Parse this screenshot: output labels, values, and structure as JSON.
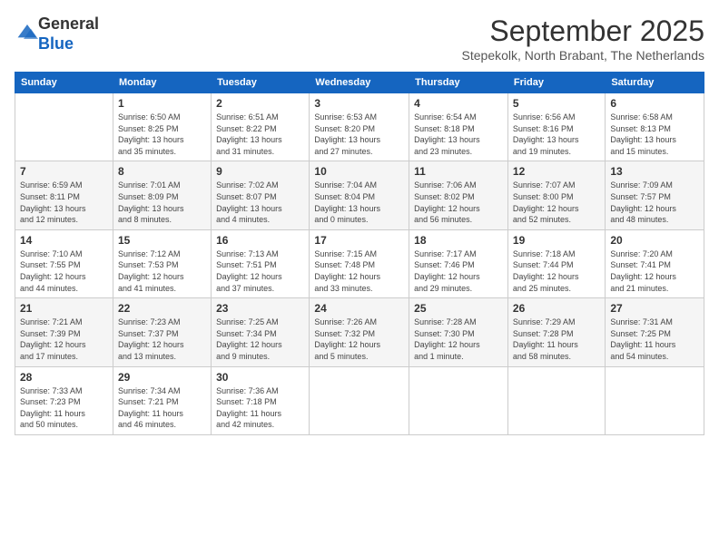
{
  "logo": {
    "general": "General",
    "blue": "Blue"
  },
  "header": {
    "month": "September 2025",
    "location": "Stepekolk, North Brabant, The Netherlands"
  },
  "days_of_week": [
    "Sunday",
    "Monday",
    "Tuesday",
    "Wednesday",
    "Thursday",
    "Friday",
    "Saturday"
  ],
  "weeks": [
    [
      {
        "day": "",
        "info": ""
      },
      {
        "day": "1",
        "info": "Sunrise: 6:50 AM\nSunset: 8:25 PM\nDaylight: 13 hours\nand 35 minutes."
      },
      {
        "day": "2",
        "info": "Sunrise: 6:51 AM\nSunset: 8:22 PM\nDaylight: 13 hours\nand 31 minutes."
      },
      {
        "day": "3",
        "info": "Sunrise: 6:53 AM\nSunset: 8:20 PM\nDaylight: 13 hours\nand 27 minutes."
      },
      {
        "day": "4",
        "info": "Sunrise: 6:54 AM\nSunset: 8:18 PM\nDaylight: 13 hours\nand 23 minutes."
      },
      {
        "day": "5",
        "info": "Sunrise: 6:56 AM\nSunset: 8:16 PM\nDaylight: 13 hours\nand 19 minutes."
      },
      {
        "day": "6",
        "info": "Sunrise: 6:58 AM\nSunset: 8:13 PM\nDaylight: 13 hours\nand 15 minutes."
      }
    ],
    [
      {
        "day": "7",
        "info": "Sunrise: 6:59 AM\nSunset: 8:11 PM\nDaylight: 13 hours\nand 12 minutes."
      },
      {
        "day": "8",
        "info": "Sunrise: 7:01 AM\nSunset: 8:09 PM\nDaylight: 13 hours\nand 8 minutes."
      },
      {
        "day": "9",
        "info": "Sunrise: 7:02 AM\nSunset: 8:07 PM\nDaylight: 13 hours\nand 4 minutes."
      },
      {
        "day": "10",
        "info": "Sunrise: 7:04 AM\nSunset: 8:04 PM\nDaylight: 13 hours\nand 0 minutes."
      },
      {
        "day": "11",
        "info": "Sunrise: 7:06 AM\nSunset: 8:02 PM\nDaylight: 12 hours\nand 56 minutes."
      },
      {
        "day": "12",
        "info": "Sunrise: 7:07 AM\nSunset: 8:00 PM\nDaylight: 12 hours\nand 52 minutes."
      },
      {
        "day": "13",
        "info": "Sunrise: 7:09 AM\nSunset: 7:57 PM\nDaylight: 12 hours\nand 48 minutes."
      }
    ],
    [
      {
        "day": "14",
        "info": "Sunrise: 7:10 AM\nSunset: 7:55 PM\nDaylight: 12 hours\nand 44 minutes."
      },
      {
        "day": "15",
        "info": "Sunrise: 7:12 AM\nSunset: 7:53 PM\nDaylight: 12 hours\nand 41 minutes."
      },
      {
        "day": "16",
        "info": "Sunrise: 7:13 AM\nSunset: 7:51 PM\nDaylight: 12 hours\nand 37 minutes."
      },
      {
        "day": "17",
        "info": "Sunrise: 7:15 AM\nSunset: 7:48 PM\nDaylight: 12 hours\nand 33 minutes."
      },
      {
        "day": "18",
        "info": "Sunrise: 7:17 AM\nSunset: 7:46 PM\nDaylight: 12 hours\nand 29 minutes."
      },
      {
        "day": "19",
        "info": "Sunrise: 7:18 AM\nSunset: 7:44 PM\nDaylight: 12 hours\nand 25 minutes."
      },
      {
        "day": "20",
        "info": "Sunrise: 7:20 AM\nSunset: 7:41 PM\nDaylight: 12 hours\nand 21 minutes."
      }
    ],
    [
      {
        "day": "21",
        "info": "Sunrise: 7:21 AM\nSunset: 7:39 PM\nDaylight: 12 hours\nand 17 minutes."
      },
      {
        "day": "22",
        "info": "Sunrise: 7:23 AM\nSunset: 7:37 PM\nDaylight: 12 hours\nand 13 minutes."
      },
      {
        "day": "23",
        "info": "Sunrise: 7:25 AM\nSunset: 7:34 PM\nDaylight: 12 hours\nand 9 minutes."
      },
      {
        "day": "24",
        "info": "Sunrise: 7:26 AM\nSunset: 7:32 PM\nDaylight: 12 hours\nand 5 minutes."
      },
      {
        "day": "25",
        "info": "Sunrise: 7:28 AM\nSunset: 7:30 PM\nDaylight: 12 hours\nand 1 minute."
      },
      {
        "day": "26",
        "info": "Sunrise: 7:29 AM\nSunset: 7:28 PM\nDaylight: 11 hours\nand 58 minutes."
      },
      {
        "day": "27",
        "info": "Sunrise: 7:31 AM\nSunset: 7:25 PM\nDaylight: 11 hours\nand 54 minutes."
      }
    ],
    [
      {
        "day": "28",
        "info": "Sunrise: 7:33 AM\nSunset: 7:23 PM\nDaylight: 11 hours\nand 50 minutes."
      },
      {
        "day": "29",
        "info": "Sunrise: 7:34 AM\nSunset: 7:21 PM\nDaylight: 11 hours\nand 46 minutes."
      },
      {
        "day": "30",
        "info": "Sunrise: 7:36 AM\nSunset: 7:18 PM\nDaylight: 11 hours\nand 42 minutes."
      },
      {
        "day": "",
        "info": ""
      },
      {
        "day": "",
        "info": ""
      },
      {
        "day": "",
        "info": ""
      },
      {
        "day": "",
        "info": ""
      }
    ]
  ]
}
